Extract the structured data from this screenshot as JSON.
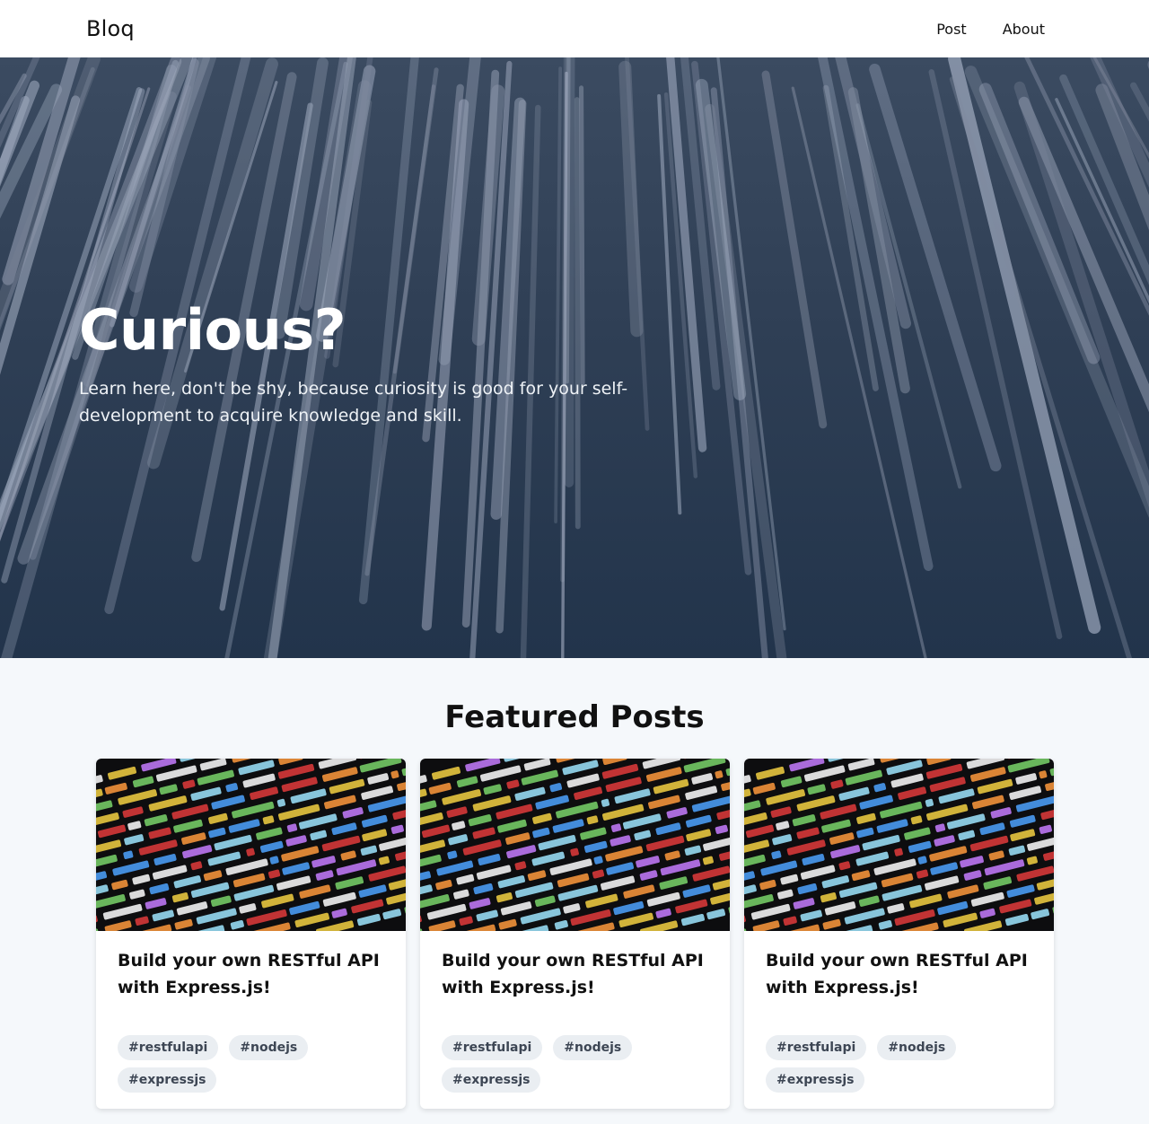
{
  "navbar": {
    "brand": "Bloq",
    "links": [
      "Post",
      "About"
    ]
  },
  "hero": {
    "title": "Curious?",
    "subtitle": "Learn here, don't be shy, because curiosity is good for your self-development to acquire knowledge and skill."
  },
  "featured": {
    "heading": "Featured Posts",
    "posts": [
      {
        "title": "Build your own RESTful API with Express.js!",
        "tags": [
          "#restfulapi",
          "#nodejs",
          "#expressjs"
        ]
      },
      {
        "title": "Build your own RESTful API with Express.js!",
        "tags": [
          "#restfulapi",
          "#nodejs",
          "#expressjs"
        ]
      },
      {
        "title": "Build your own RESTful API with Express.js!",
        "tags": [
          "#restfulapi",
          "#nodejs",
          "#expressjs"
        ]
      }
    ]
  },
  "colors": {
    "hero_bg": "#2f3f55",
    "page_bg": "#f5f8fb",
    "tag_bg": "#eaeef2"
  }
}
